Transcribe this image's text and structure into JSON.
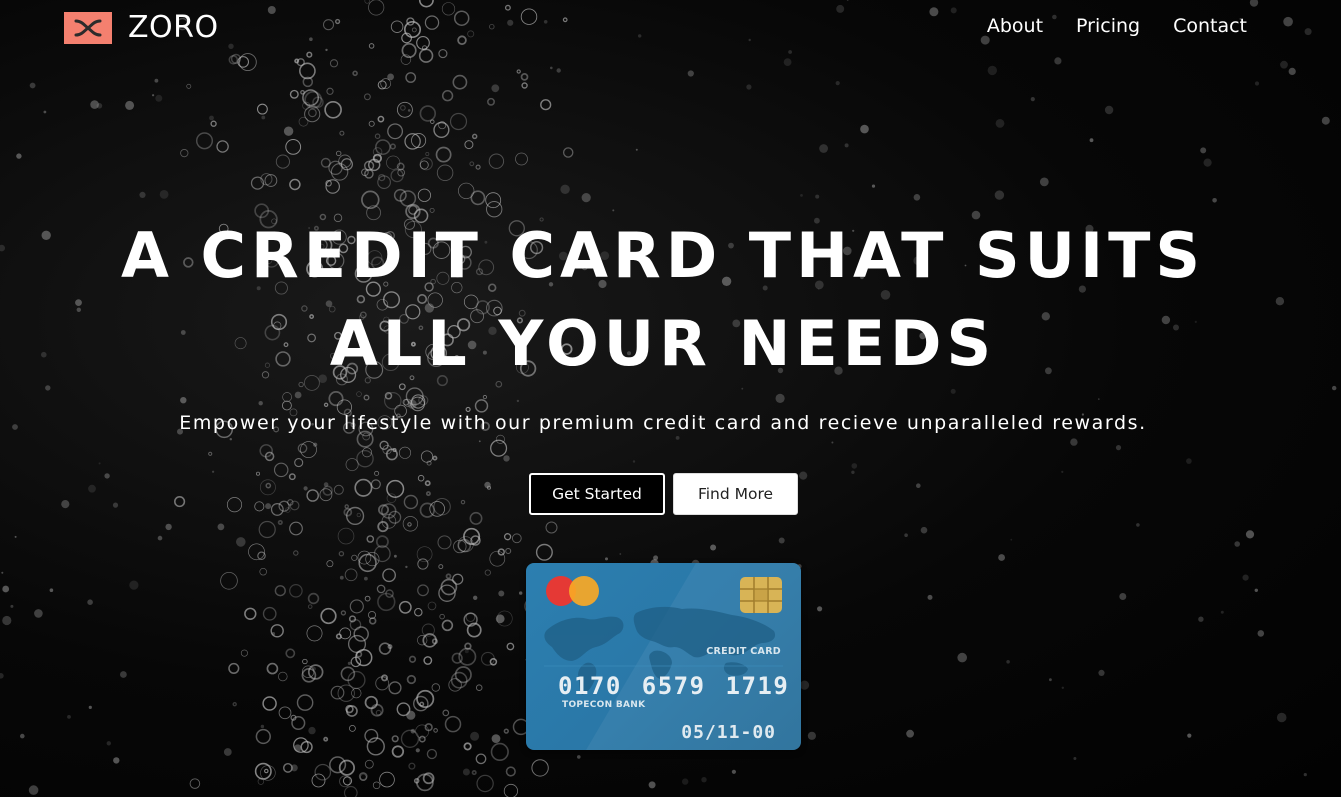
{
  "brand": {
    "name": "ZORO",
    "logo_color": "#f4806f"
  },
  "nav": {
    "items": [
      {
        "label": "About"
      },
      {
        "label": "Pricing"
      },
      {
        "label": "Contact"
      }
    ]
  },
  "hero": {
    "title_line1": "A CREDIT CARD THAT SUITS",
    "title_line2": "ALL YOUR NEEDS",
    "subtitle": "Empower your lifestyle with our premium credit card and recieve unparalleled rewards.",
    "primary_button": "Get Started",
    "secondary_button": "Find More"
  },
  "card": {
    "type_label": "CREDIT CARD",
    "number": "0170 6579 1719",
    "bank": "TOPECON BANK",
    "expiry": "05/11-00",
    "color": "#2c7fb0"
  }
}
